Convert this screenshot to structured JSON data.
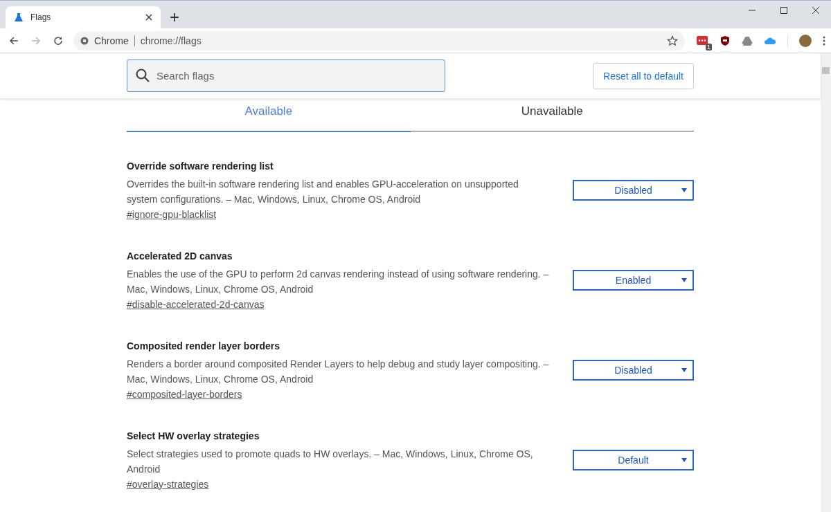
{
  "browser_tab": {
    "title": "Flags",
    "selected": true
  },
  "address_bar": {
    "site_label": "Chrome",
    "url": "chrome://flags"
  },
  "extensions": [
    {
      "kind": "password",
      "badge": "1"
    },
    {
      "kind": "shield"
    },
    {
      "kind": "drive"
    },
    {
      "kind": "cloud"
    }
  ],
  "search": {
    "placeholder": "Search flags"
  },
  "reset_button": "Reset all to default",
  "tabs": [
    {
      "label": "Available",
      "selected": true
    },
    {
      "label": "Unavailable",
      "selected": false
    }
  ],
  "flags": [
    {
      "title": "Override software rendering list",
      "description": "Overrides the built-in software rendering list and enables GPU-acceleration on unsupported system configurations. – Mac, Windows, Linux, Chrome OS, Android",
      "link": "#ignore-gpu-blacklist",
      "value": "Disabled"
    },
    {
      "title": "Accelerated 2D canvas",
      "description": "Enables the use of the GPU to perform 2d canvas rendering instead of using software rendering. – Mac, Windows, Linux, Chrome OS, Android",
      "link": "#disable-accelerated-2d-canvas",
      "value": "Enabled"
    },
    {
      "title": "Composited render layer borders",
      "description": "Renders a border around composited Render Layers to help debug and study layer compositing. – Mac, Windows, Linux, Chrome OS, Android",
      "link": "#composited-layer-borders",
      "value": "Disabled"
    },
    {
      "title": "Select HW overlay strategies",
      "description": "Select strategies used to promote quads to HW overlays. – Mac, Windows, Linux, Chrome OS, Android",
      "link": "#overlay-strategies",
      "value": "Default"
    }
  ]
}
